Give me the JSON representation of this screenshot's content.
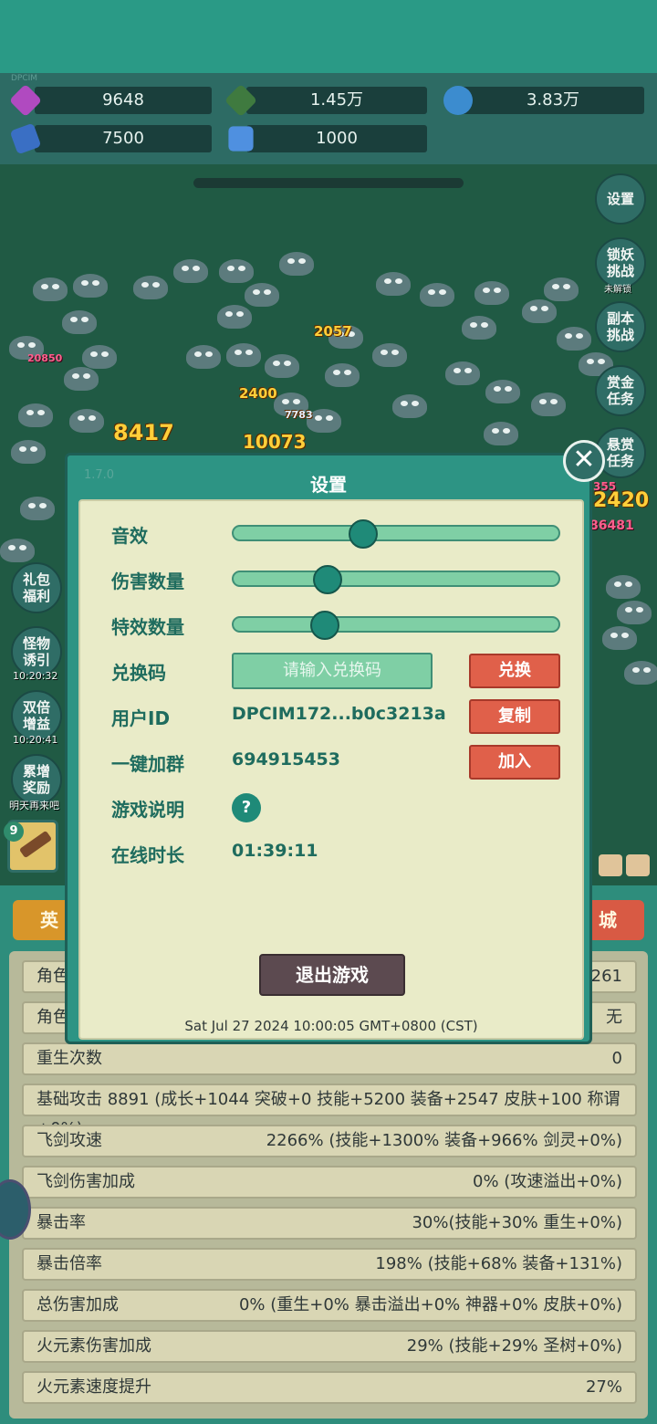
{
  "resources": {
    "small_label": "DPCIM",
    "gem": "9648",
    "jade": "1.45万",
    "orb": "3.83万",
    "book": "7500",
    "crystal": "1000"
  },
  "side_buttons": {
    "settings": "设置",
    "lock_demon": "锁妖挑战",
    "lock_demon_sub": "未解锁",
    "dungeon": "副本挑战",
    "gold_task": "赏金任务",
    "bounty_task": "悬赏任务",
    "gift": "礼包福利",
    "lure": "怪物诱引",
    "lure_time": "10:20:32",
    "double": "双倍增益",
    "double_time": "10:20:41",
    "accumulate": "累增奖励",
    "accumulate_sub": "明天再来吧"
  },
  "damage_numbers": [
    "8417",
    "10073",
    "2400",
    "2057",
    "7783",
    "20850",
    "2420",
    "86481",
    "355"
  ],
  "item_slot": {
    "badge": "9"
  },
  "tabs": {
    "left": "英",
    "right": "城"
  },
  "stats": [
    {
      "label": "角色",
      "value": "261"
    },
    {
      "label": "角色",
      "value": "无"
    },
    {
      "label": "重生次数",
      "value": "0"
    },
    {
      "label": "基础攻击  8891 (成长+1044 突破+0 技能+5200 装备+2547 皮肤+100 称谓+0%)",
      "value": ""
    },
    {
      "label": "飞剑攻速",
      "value": "2266% (技能+1300% 装备+966% 剑灵+0%)"
    },
    {
      "label": "飞剑伤害加成",
      "value": "0% (攻速溢出+0%)"
    },
    {
      "label": "暴击率",
      "value": "30%(技能+30% 重生+0%)"
    },
    {
      "label": "暴击倍率",
      "value": "198% (技能+68% 装备+131%)"
    },
    {
      "label": "总伤害加成",
      "value": "0% (重生+0% 暴击溢出+0% 神器+0% 皮肤+0%)"
    },
    {
      "label": "火元素伤害加成",
      "value": "29% (技能+29% 圣树+0%)"
    },
    {
      "label": "火元素速度提升",
      "value": "27%"
    }
  ],
  "modal": {
    "version": "1.7.0",
    "title": "设置",
    "sound_label": "音效",
    "sound_level": 0.4,
    "damage_count_label": "伤害数量",
    "damage_count_level": 0.29,
    "effect_count_label": "特效数量",
    "effect_count_level": 0.28,
    "redeem_label": "兑换码",
    "redeem_placeholder": "请输入兑换码",
    "redeem_button": "兑换",
    "user_id_label": "用户ID",
    "user_id_value": "DPCIM172...b0c3213a",
    "copy_button": "复制",
    "group_label": "一键加群",
    "group_value": "694915453",
    "join_button": "加入",
    "help_label": "游戏说明",
    "help_icon": "?",
    "online_label": "在线时长",
    "online_value": "01:39:11",
    "exit_button": "退出游戏",
    "timestamp": "Sat Jul 27 2024 10:00:05 GMT+0800 (CST)"
  },
  "close_icon": "✕",
  "colors": {
    "accent": "#2a9a86",
    "panel": "#e9ebc8",
    "button_red": "#e0604a",
    "knob": "#1f8a78"
  }
}
